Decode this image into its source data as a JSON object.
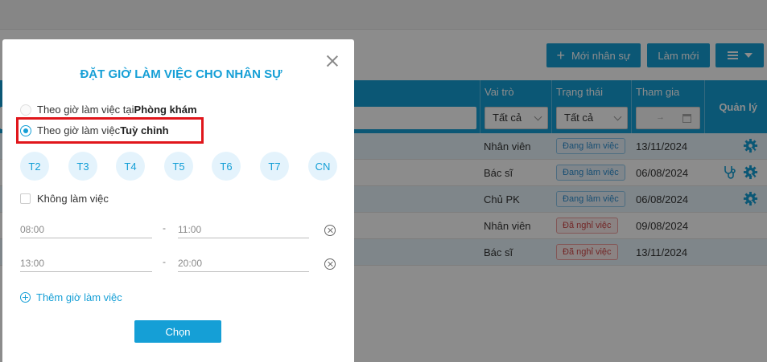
{
  "toolbar": {
    "new_staff_label": "Mới nhân sự",
    "refresh_label": "Làm mới"
  },
  "table": {
    "headers": {
      "role": "Vai trò",
      "status": "Trạng thái",
      "join": "Tham gia",
      "manage": "Quản lý"
    },
    "filters": {
      "role": "Tất cả",
      "status": "Tất cả",
      "date_arrow": "→"
    },
    "rows": [
      {
        "role": "Nhân viên",
        "status": "Đang làm việc",
        "status_type": "active",
        "join": "13/11/2024",
        "icons": [
          "gear-icon"
        ]
      },
      {
        "role": "Bác sĩ",
        "status": "Đang làm việc",
        "status_type": "active",
        "join": "06/08/2024",
        "icons": [
          "stethoscope-icon",
          "gear-icon"
        ]
      },
      {
        "role": "Chủ PK",
        "status": "Đang làm việc",
        "status_type": "active",
        "join": "06/08/2024",
        "icons": [
          "gear-icon"
        ]
      },
      {
        "role": "Nhân viên",
        "status": "Đã nghỉ việc",
        "status_type": "off",
        "join": "09/08/2024",
        "icons": []
      },
      {
        "role": "Bác sĩ",
        "status": "Đã nghỉ việc",
        "status_type": "off",
        "join": "13/11/2024",
        "icons": []
      }
    ]
  },
  "modal": {
    "title": "ĐẶT GIỜ LÀM VIỆC CHO NHÂN SỰ",
    "option_clinic": {
      "prefix": "Theo giờ làm việc tại ",
      "bold": "Phòng khám",
      "checked": false
    },
    "option_custom": {
      "prefix": "Theo giờ làm việc ",
      "bold": "Tuỳ chỉnh",
      "checked": true
    },
    "days": [
      "T2",
      "T3",
      "T4",
      "T5",
      "T6",
      "T7",
      "CN"
    ],
    "not_working_label": "Không làm việc",
    "time_ranges": [
      {
        "from": "08:00",
        "to": "11:00"
      },
      {
        "from": "13:00",
        "to": "20:00"
      }
    ],
    "range_separator": "-",
    "add_hours_label": "Thêm giờ làm việc",
    "choose_label": "Chọn"
  },
  "colors": {
    "accent": "#159fd6",
    "highlight_border": "#e0161b",
    "active_badge": "#2d8fd1",
    "off_badge": "#d04848"
  }
}
